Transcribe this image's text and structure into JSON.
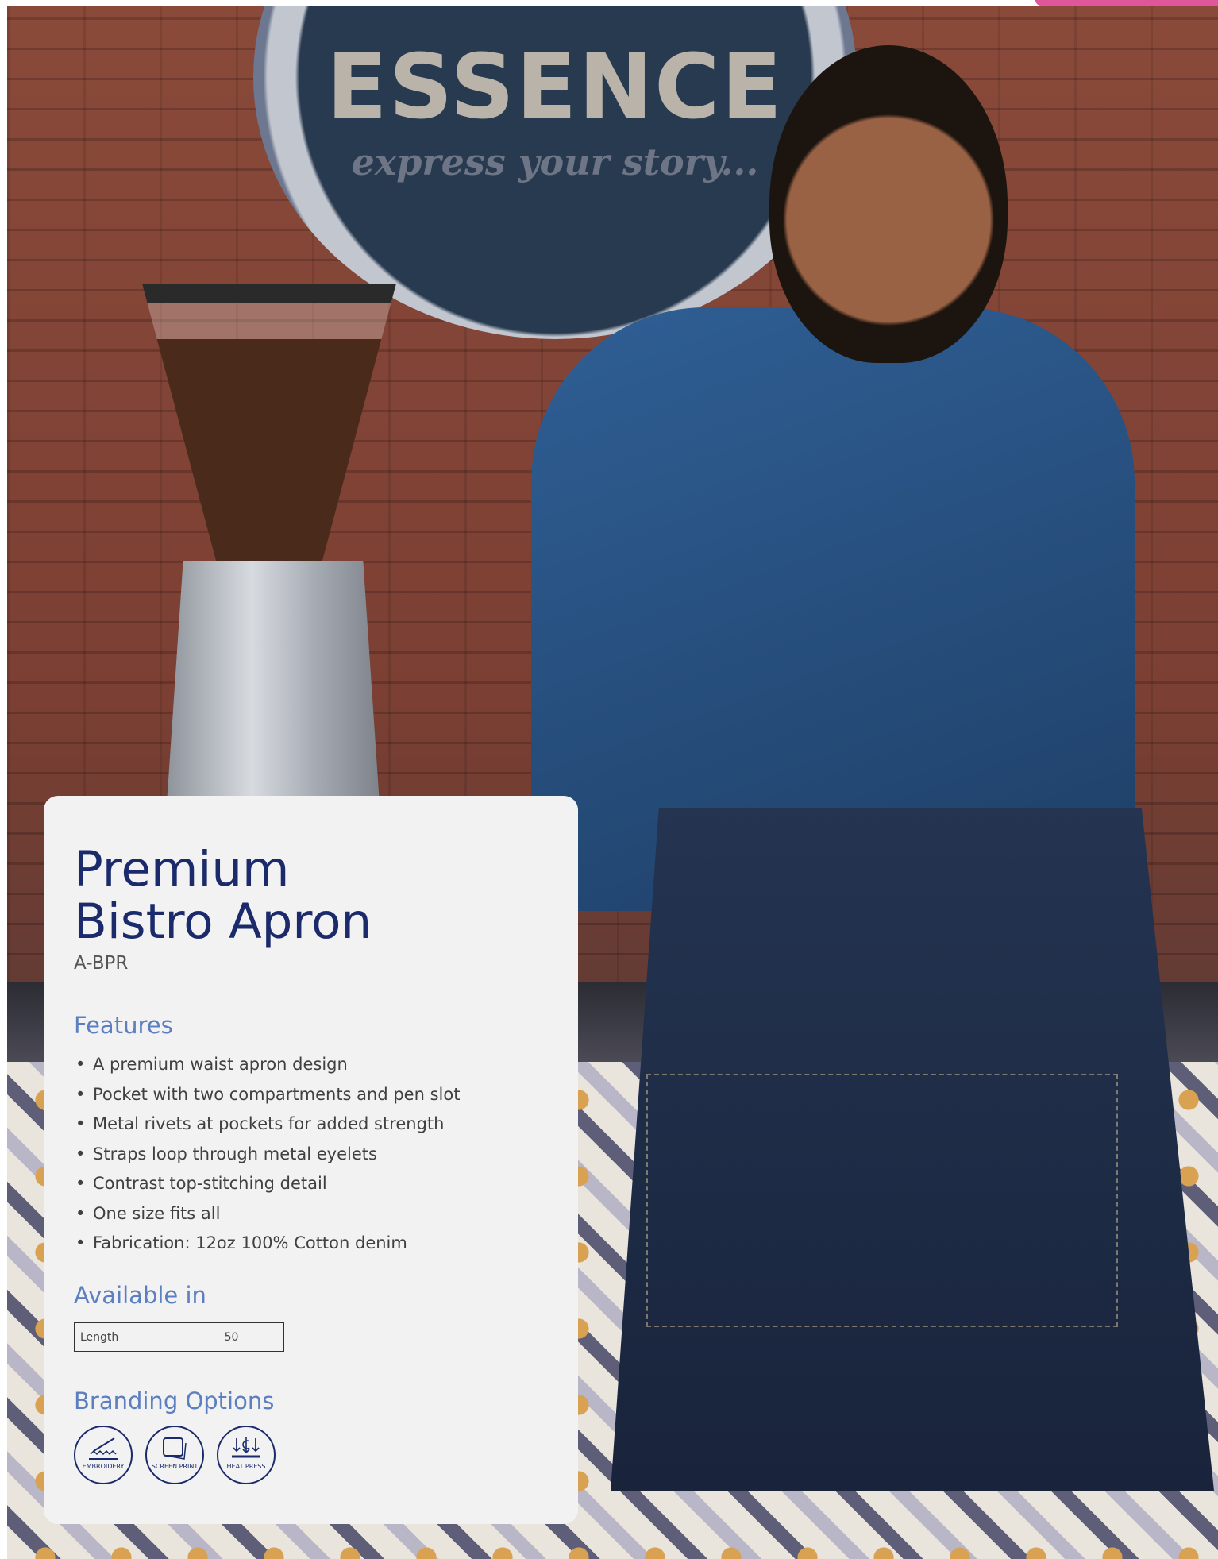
{
  "background": {
    "sign_title": "ESSENCE",
    "sign_subtitle": "express your story..."
  },
  "product": {
    "title_line1": "Premium",
    "title_line2": "Bistro Apron",
    "code": "A-BPR"
  },
  "features": {
    "heading": "Features",
    "items": [
      "A premium waist apron design",
      "Pocket with two compartments and pen slot",
      "Metal rivets at pockets for added strength",
      "Straps loop through metal eyelets",
      "Contrast top-stitching detail",
      "One size fits all",
      "Fabrication: 12oz 100% Cotton denim"
    ]
  },
  "availability": {
    "heading": "Available in",
    "rows": [
      {
        "label": "Length",
        "value": "50"
      }
    ]
  },
  "branding": {
    "heading": "Branding Options",
    "options": [
      {
        "label": "EMBROIDERY",
        "icon": "embroidery-icon"
      },
      {
        "label": "SCREEN PRINT",
        "icon": "screen-print-icon"
      },
      {
        "label": "HEAT PRESS",
        "icon": "heat-press-icon"
      }
    ]
  },
  "colors": {
    "title": "#1b2a6b",
    "section_heading": "#5b7fc0",
    "card_bg": "#f2f2f2",
    "accent_tab": "#e0569b"
  }
}
